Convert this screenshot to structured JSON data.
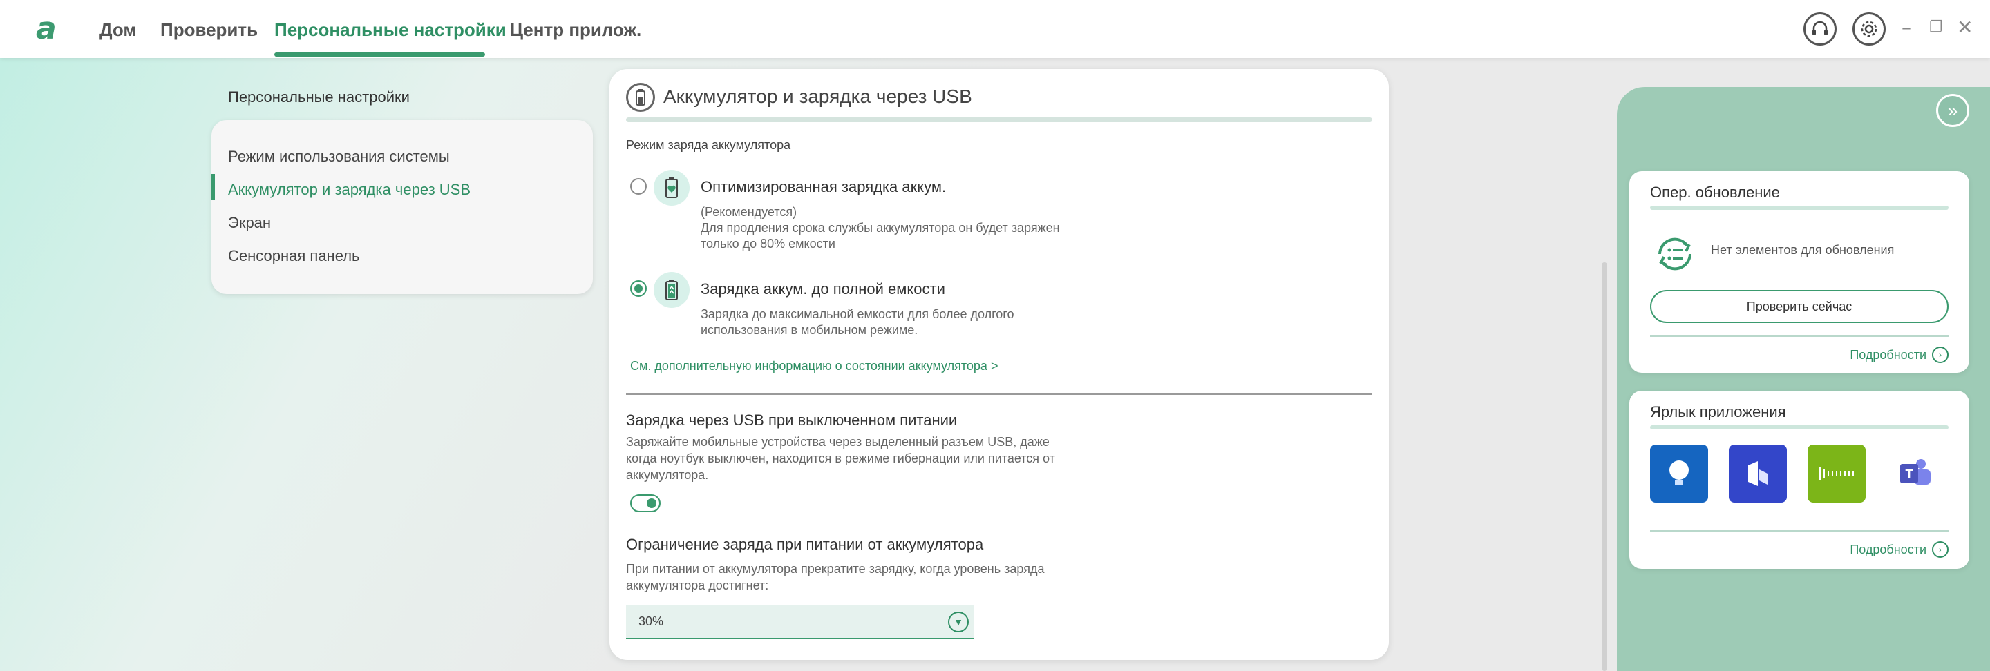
{
  "topbar": {
    "logo": "a",
    "tabs": [
      {
        "label": "Дом"
      },
      {
        "label": "Проверить"
      },
      {
        "label": "Персональные настройки"
      },
      {
        "label": "Центр прилож."
      }
    ],
    "active_tab_index": 2,
    "icons": [
      "headset-icon",
      "settings-gear-icon"
    ],
    "window_controls": [
      "minimize-icon",
      "restore-icon",
      "close-icon"
    ]
  },
  "left": {
    "title": "Персональные настройки",
    "items": [
      {
        "label": "Режим использования системы"
      },
      {
        "label": "Аккумулятор и зарядка через USB"
      },
      {
        "label": "Экран"
      },
      {
        "label": "Сенсорная панель"
      }
    ],
    "active_index": 1
  },
  "main": {
    "title": "Аккумулятор и зарядка через USB",
    "mode_label": "Режим заряда аккумулятора",
    "options": [
      {
        "title": "Оптимизированная зарядка аккум.",
        "note": "(Рекомендуется)",
        "desc": "Для продления срока службы аккумулятора он будет заряжен только до 80% емкости",
        "selected": false
      },
      {
        "title": "Зарядка аккум. до полной емкости",
        "desc": "Зарядка до максимальной емкости для более долгого использования в мобильном режиме.",
        "selected": true
      }
    ],
    "info_link": "См. дополнительную информацию о состоянии аккумулятора >",
    "usb": {
      "title": "Зарядка через USB при выключенном питании",
      "desc": "Заряжайте мобильные устройства через выделенный разъем USB, даже когда ноутбук выключен, находится в режиме гибернации или питается от аккумулятора.",
      "enabled": true
    },
    "limit": {
      "title": "Ограничение заряда при питании от аккумулятора",
      "desc": "При питании от аккумулятора прекратите зарядку, когда уровень заряда аккумулятора достигнет:",
      "value": "30%"
    }
  },
  "right": {
    "update": {
      "title": "Опер. обновление",
      "status": "Нет элементов для обновления",
      "button": "Проверить сейчас",
      "more": "Подробности"
    },
    "shortcuts": {
      "title": "Ярлык приложения",
      "apps": [
        "lightbulb-app-icon",
        "stacked-app-icon",
        "audio-wave-app-icon",
        "teams-app-icon"
      ],
      "more": "Подробности"
    }
  },
  "colors": {
    "accent": "#3a9a6e",
    "accent_text": "#2f8f64",
    "panel": "#9ecbb6"
  }
}
